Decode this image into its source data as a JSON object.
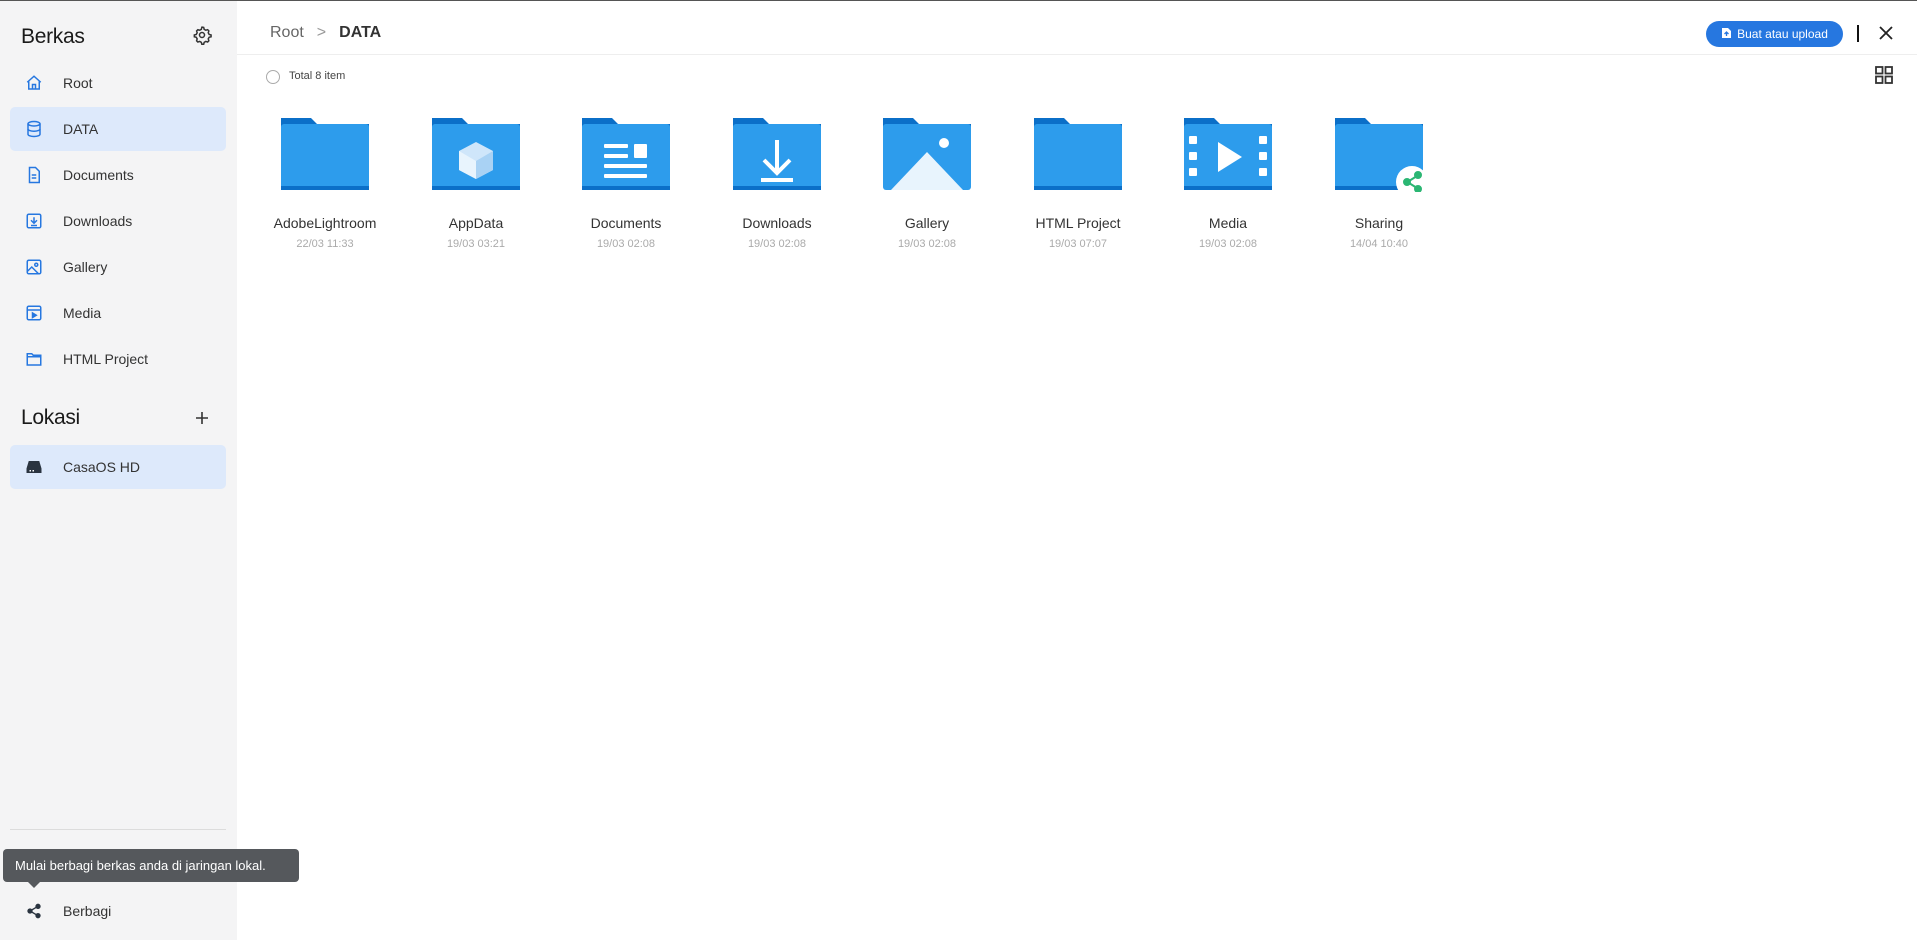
{
  "sidebar": {
    "title": "Berkas",
    "settings_icon": "gear-icon",
    "items": [
      {
        "label": "Root",
        "icon": "home-icon",
        "active": false
      },
      {
        "label": "DATA",
        "icon": "database-icon",
        "active": true
      },
      {
        "label": "Documents",
        "icon": "document-icon",
        "active": false
      },
      {
        "label": "Downloads",
        "icon": "download-icon",
        "active": false
      },
      {
        "label": "Gallery",
        "icon": "image-icon",
        "active": false
      },
      {
        "label": "Media",
        "icon": "video-icon",
        "active": false
      },
      {
        "label": "HTML Project",
        "icon": "folder-icon",
        "active": false
      }
    ],
    "locations_title": "Lokasi",
    "locations": [
      {
        "label": "CasaOS HD",
        "icon": "hard-drive-icon",
        "active": true
      }
    ],
    "share": {
      "label": "Berbagi",
      "icon": "share-icon"
    },
    "tooltip": "Mulai berbagi berkas anda di jaringan lokal."
  },
  "header": {
    "breadcrumb": [
      "Root",
      "DATA"
    ],
    "breadcrumb_separator": ">",
    "upload_label": "Buat atau upload"
  },
  "toolbar": {
    "total_label": "Total 8 item"
  },
  "files": [
    {
      "name": "AdobeLightroom",
      "date": "22/03 11:33",
      "icon": "folder-icon"
    },
    {
      "name": "AppData",
      "date": "19/03 03:21",
      "icon": "folder-app-icon"
    },
    {
      "name": "Documents",
      "date": "19/03 02:08",
      "icon": "folder-documents-icon"
    },
    {
      "name": "Downloads",
      "date": "19/03 02:08",
      "icon": "folder-downloads-icon"
    },
    {
      "name": "Gallery",
      "date": "19/03 02:08",
      "icon": "folder-gallery-icon"
    },
    {
      "name": "HTML Project",
      "date": "19/03 07:07",
      "icon": "folder-icon"
    },
    {
      "name": "Media",
      "date": "19/03 02:08",
      "icon": "folder-media-icon"
    },
    {
      "name": "Sharing",
      "date": "14/04 10:40",
      "icon": "folder-shared-icon"
    }
  ],
  "colors": {
    "accent": "#2677e0",
    "active_bg": "#dde9fb",
    "folder_light": "#2d9cec",
    "folder_dark": "#0b6fc8",
    "share_green": "#2bb673"
  }
}
